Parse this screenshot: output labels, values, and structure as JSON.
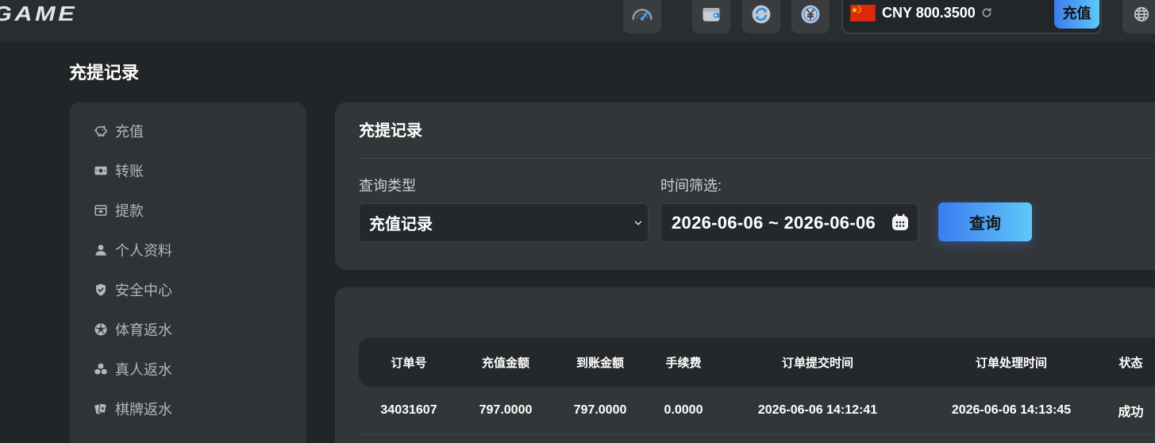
{
  "header": {
    "logo": "GAME",
    "icon_buttons": [
      "speedometer-icon",
      "wallet-icon",
      "sync-icon",
      "yen-coin-icon"
    ],
    "balance": {
      "flag": "china-flag-icon",
      "currency": "CNY",
      "amount": "800.3500",
      "refresh_icon": "refresh-icon",
      "deposit_label": "充值"
    },
    "language_icon": "globe-icon"
  },
  "page_title": "充提记录",
  "sidebar": {
    "items": [
      {
        "label": "充值",
        "icon": "piggy-bank-icon"
      },
      {
        "label": "转账",
        "icon": "money-bill-icon"
      },
      {
        "label": "提款",
        "icon": "withdraw-icon"
      },
      {
        "label": "个人资料",
        "icon": "user-icon"
      },
      {
        "label": "安全中心",
        "icon": "shield-check-icon"
      },
      {
        "label": "体育返水",
        "icon": "soccer-ball-icon"
      },
      {
        "label": "真人返水",
        "icon": "cubes-icon"
      },
      {
        "label": "棋牌返水",
        "icon": "playing-cards-icon"
      }
    ]
  },
  "filter": {
    "title": "充提记录",
    "type_label": "查询类型",
    "type_selected": "充值记录",
    "date_label": "时间筛选:",
    "date_range": "2026-06-06 ~ 2026-06-06",
    "query_label": "查询"
  },
  "records": {
    "columns": [
      "订单号",
      "充值金额",
      "到账金额",
      "手续费",
      "订单提交时间",
      "订单处理时间",
      "状态"
    ],
    "rows": [
      [
        "34031607",
        "797.0000",
        "797.0000",
        "0.0000",
        "2026-06-06 14:12:41",
        "2026-06-06 14:13:45",
        "成功"
      ]
    ]
  },
  "colors": {
    "background": "#222527",
    "header": "#2a2d30",
    "card": "#323638",
    "sidebar": "#2f3335",
    "input": "#25282b",
    "accent_start": "#3b7cf0",
    "accent_end": "#5ec8f7",
    "text": "#ffffff",
    "muted_text": "#b3b7ba"
  }
}
